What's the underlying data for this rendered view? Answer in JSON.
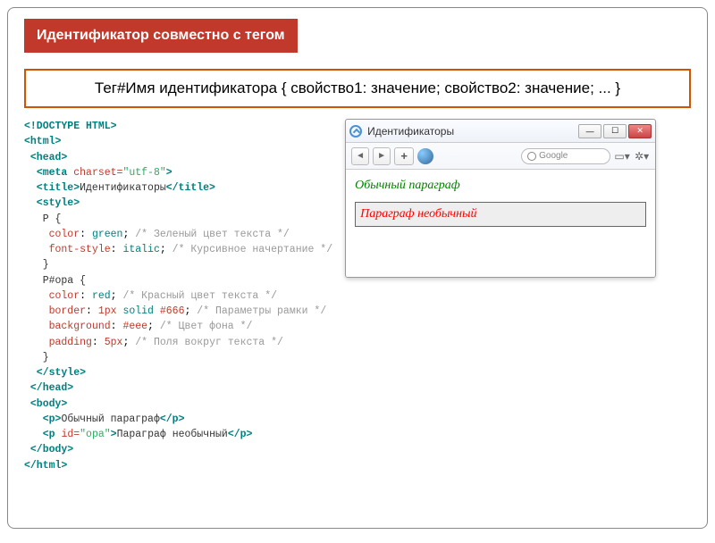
{
  "banner": "Идентификатор совместно с тегом",
  "syntax": "Тег#Имя идентификатора { свойство1: значение; свойство2: значение; ... }",
  "code": {
    "doctype": "<!DOCTYPE HTML>",
    "html_open": "<html>",
    "head_open": " <head>",
    "meta": "  <meta charset=\"utf-8\">",
    "title_open": "  <title>",
    "title_text": "Идентификаторы",
    "title_close": "</title>",
    "style_open": "  <style>",
    "sel1": "   P {",
    "p1a_prop": "    color",
    "p1a_val": "green",
    "p1a_comment": "/* Зеленый цвет текста */",
    "p1b_prop": "    font-style",
    "p1b_val": "italic",
    "p1b_comment": "/* Курсивное начертание */",
    "sel1_close": "   }",
    "sel2": "   P#opa {",
    "p2a_prop": "    color",
    "p2a_val": "red",
    "p2a_comment": "/* Красный цвет текста */",
    "p2b_prop": "    border",
    "p2b_val": "1px solid #666",
    "p2b_comment": "/* Параметры рамки */",
    "p2c_prop": "    background",
    "p2c_val": "#eee",
    "p2c_comment": "/* Цвет фона */",
    "p2d_prop": "    padding",
    "p2d_val": "5px",
    "p2d_comment": "/* Поля вокруг текста */",
    "sel2_close": "   }",
    "style_close": "  </style>",
    "head_close": " </head>",
    "body_open": " <body>",
    "p_line1_open": "   <p>",
    "p_line1_text": "Обычный параграф",
    "p_line1_close": "</p>",
    "p_line2_open": "   <p id=\"opa\">",
    "p_line2_text": "Параграф необычный",
    "p_line2_close": "</p>",
    "body_close": " </body>",
    "html_close": "</html>"
  },
  "browser": {
    "title": "Идентификаторы",
    "search_placeholder": "Google",
    "para_normal": "Обычный параграф",
    "para_special": "Параграф необычный"
  }
}
